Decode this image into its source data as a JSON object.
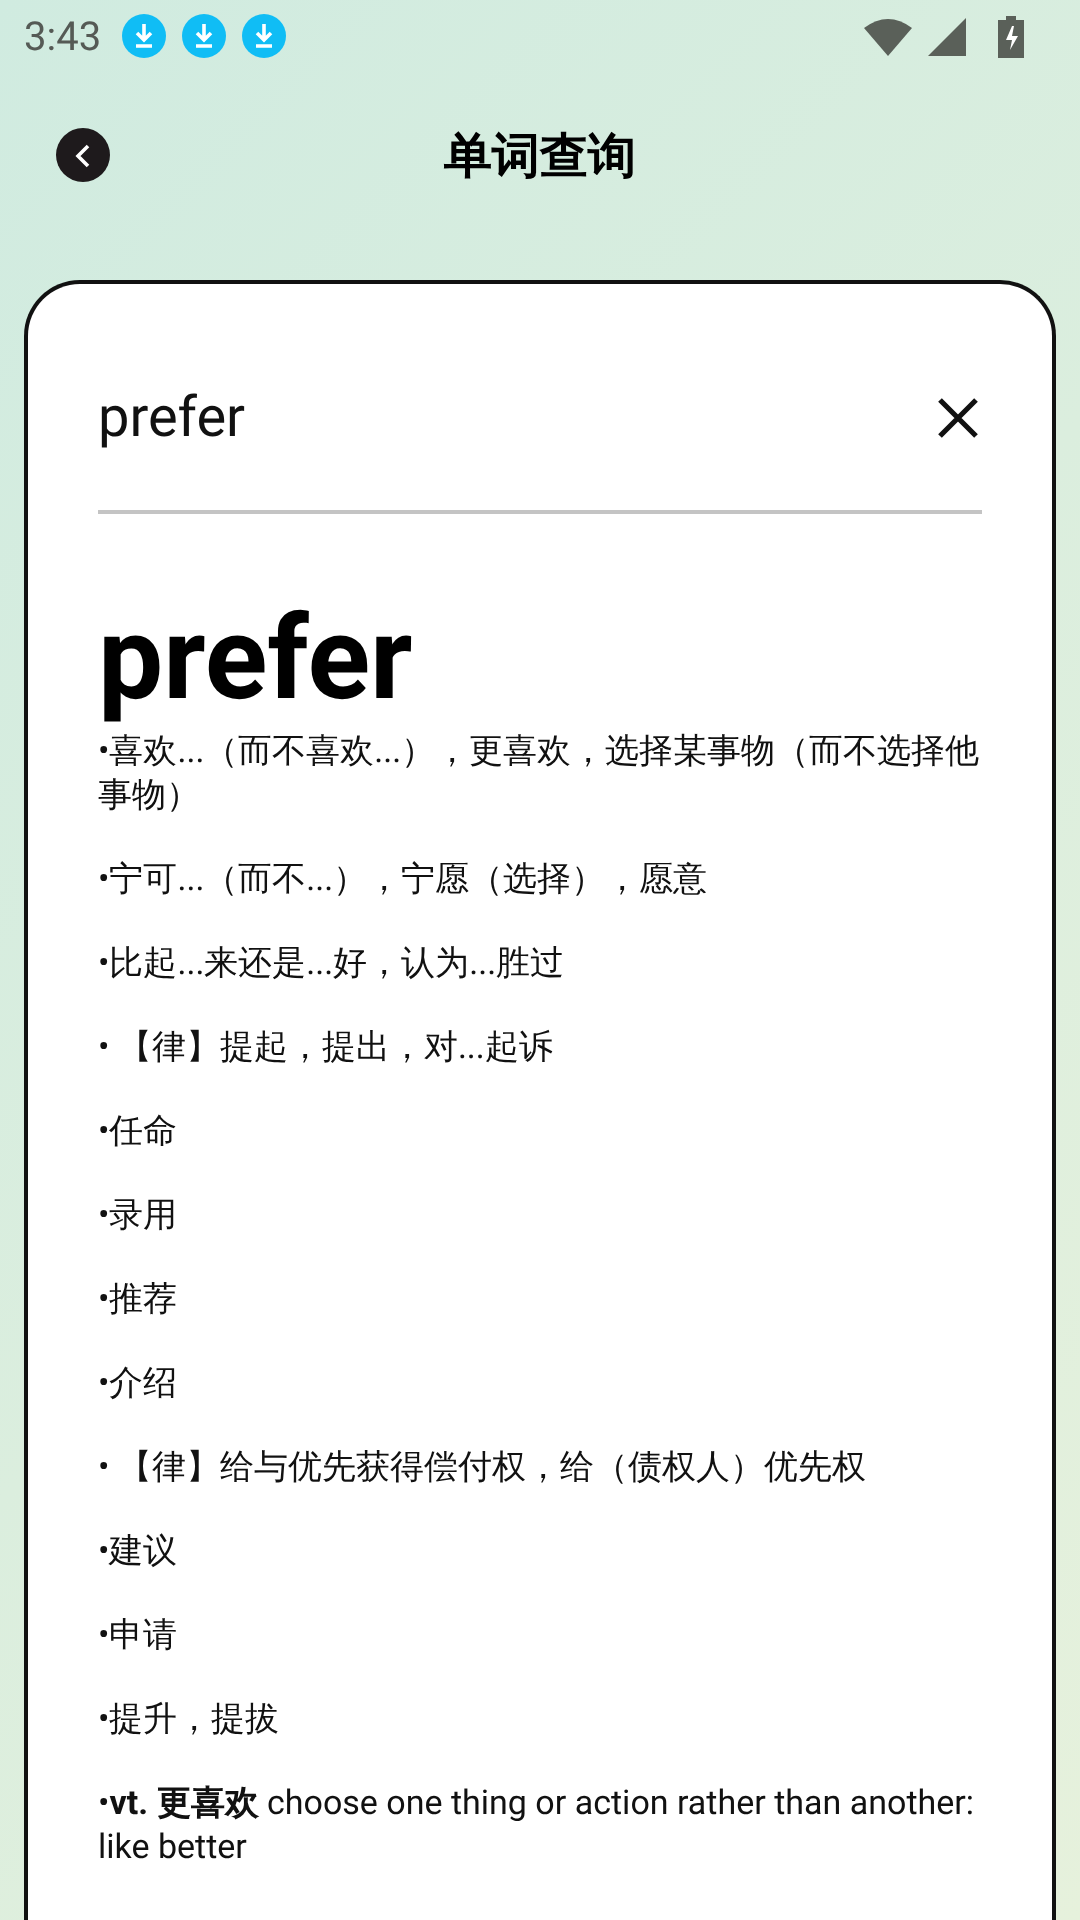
{
  "status_bar": {
    "time": "3:43",
    "notifications": [
      {
        "kind": "download"
      },
      {
        "kind": "download"
      },
      {
        "kind": "download"
      }
    ]
  },
  "header": {
    "title": "单词查询"
  },
  "search": {
    "value": "prefer"
  },
  "word": "prefer",
  "definitions": [
    "•喜欢...（而不喜欢...），更喜欢，选择某事物（而不选择他事物）",
    "•宁可...（而不...），宁愿（选择），愿意",
    "•比起...来还是...好，认为...胜过",
    "• 【律】提起，提出，对...起诉",
    "•任命",
    "•录用",
    "•推荐",
    "•介绍",
    "• 【律】给与优先获得偿付权，给（债权人）优先权",
    "•建议",
    "•申请",
    "•提升，提拔",
    "•**vt. 更喜欢** choose one thing or action rather than another: like better"
  ]
}
